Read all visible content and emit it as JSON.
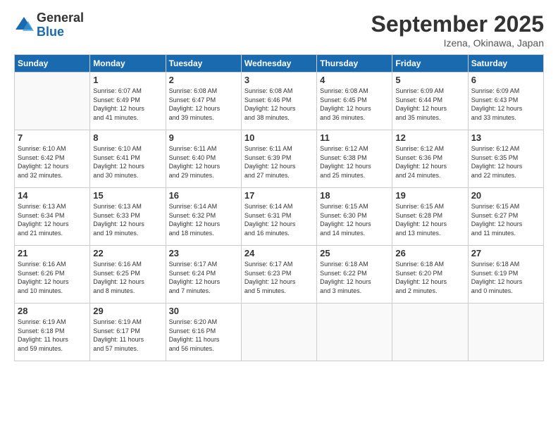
{
  "logo": {
    "general": "General",
    "blue": "Blue"
  },
  "title": "September 2025",
  "location": "Izena, Okinawa, Japan",
  "days_of_week": [
    "Sunday",
    "Monday",
    "Tuesday",
    "Wednesday",
    "Thursday",
    "Friday",
    "Saturday"
  ],
  "weeks": [
    [
      {
        "day": "",
        "info": ""
      },
      {
        "day": "1",
        "info": "Sunrise: 6:07 AM\nSunset: 6:49 PM\nDaylight: 12 hours\nand 41 minutes."
      },
      {
        "day": "2",
        "info": "Sunrise: 6:08 AM\nSunset: 6:47 PM\nDaylight: 12 hours\nand 39 minutes."
      },
      {
        "day": "3",
        "info": "Sunrise: 6:08 AM\nSunset: 6:46 PM\nDaylight: 12 hours\nand 38 minutes."
      },
      {
        "day": "4",
        "info": "Sunrise: 6:08 AM\nSunset: 6:45 PM\nDaylight: 12 hours\nand 36 minutes."
      },
      {
        "day": "5",
        "info": "Sunrise: 6:09 AM\nSunset: 6:44 PM\nDaylight: 12 hours\nand 35 minutes."
      },
      {
        "day": "6",
        "info": "Sunrise: 6:09 AM\nSunset: 6:43 PM\nDaylight: 12 hours\nand 33 minutes."
      }
    ],
    [
      {
        "day": "7",
        "info": "Sunrise: 6:10 AM\nSunset: 6:42 PM\nDaylight: 12 hours\nand 32 minutes."
      },
      {
        "day": "8",
        "info": "Sunrise: 6:10 AM\nSunset: 6:41 PM\nDaylight: 12 hours\nand 30 minutes."
      },
      {
        "day": "9",
        "info": "Sunrise: 6:11 AM\nSunset: 6:40 PM\nDaylight: 12 hours\nand 29 minutes."
      },
      {
        "day": "10",
        "info": "Sunrise: 6:11 AM\nSunset: 6:39 PM\nDaylight: 12 hours\nand 27 minutes."
      },
      {
        "day": "11",
        "info": "Sunrise: 6:12 AM\nSunset: 6:38 PM\nDaylight: 12 hours\nand 25 minutes."
      },
      {
        "day": "12",
        "info": "Sunrise: 6:12 AM\nSunset: 6:36 PM\nDaylight: 12 hours\nand 24 minutes."
      },
      {
        "day": "13",
        "info": "Sunrise: 6:12 AM\nSunset: 6:35 PM\nDaylight: 12 hours\nand 22 minutes."
      }
    ],
    [
      {
        "day": "14",
        "info": "Sunrise: 6:13 AM\nSunset: 6:34 PM\nDaylight: 12 hours\nand 21 minutes."
      },
      {
        "day": "15",
        "info": "Sunrise: 6:13 AM\nSunset: 6:33 PM\nDaylight: 12 hours\nand 19 minutes."
      },
      {
        "day": "16",
        "info": "Sunrise: 6:14 AM\nSunset: 6:32 PM\nDaylight: 12 hours\nand 18 minutes."
      },
      {
        "day": "17",
        "info": "Sunrise: 6:14 AM\nSunset: 6:31 PM\nDaylight: 12 hours\nand 16 minutes."
      },
      {
        "day": "18",
        "info": "Sunrise: 6:15 AM\nSunset: 6:30 PM\nDaylight: 12 hours\nand 14 minutes."
      },
      {
        "day": "19",
        "info": "Sunrise: 6:15 AM\nSunset: 6:28 PM\nDaylight: 12 hours\nand 13 minutes."
      },
      {
        "day": "20",
        "info": "Sunrise: 6:15 AM\nSunset: 6:27 PM\nDaylight: 12 hours\nand 11 minutes."
      }
    ],
    [
      {
        "day": "21",
        "info": "Sunrise: 6:16 AM\nSunset: 6:26 PM\nDaylight: 12 hours\nand 10 minutes."
      },
      {
        "day": "22",
        "info": "Sunrise: 6:16 AM\nSunset: 6:25 PM\nDaylight: 12 hours\nand 8 minutes."
      },
      {
        "day": "23",
        "info": "Sunrise: 6:17 AM\nSunset: 6:24 PM\nDaylight: 12 hours\nand 7 minutes."
      },
      {
        "day": "24",
        "info": "Sunrise: 6:17 AM\nSunset: 6:23 PM\nDaylight: 12 hours\nand 5 minutes."
      },
      {
        "day": "25",
        "info": "Sunrise: 6:18 AM\nSunset: 6:22 PM\nDaylight: 12 hours\nand 3 minutes."
      },
      {
        "day": "26",
        "info": "Sunrise: 6:18 AM\nSunset: 6:20 PM\nDaylight: 12 hours\nand 2 minutes."
      },
      {
        "day": "27",
        "info": "Sunrise: 6:18 AM\nSunset: 6:19 PM\nDaylight: 12 hours\nand 0 minutes."
      }
    ],
    [
      {
        "day": "28",
        "info": "Sunrise: 6:19 AM\nSunset: 6:18 PM\nDaylight: 11 hours\nand 59 minutes."
      },
      {
        "day": "29",
        "info": "Sunrise: 6:19 AM\nSunset: 6:17 PM\nDaylight: 11 hours\nand 57 minutes."
      },
      {
        "day": "30",
        "info": "Sunrise: 6:20 AM\nSunset: 6:16 PM\nDaylight: 11 hours\nand 56 minutes."
      },
      {
        "day": "",
        "info": ""
      },
      {
        "day": "",
        "info": ""
      },
      {
        "day": "",
        "info": ""
      },
      {
        "day": "",
        "info": ""
      }
    ]
  ]
}
